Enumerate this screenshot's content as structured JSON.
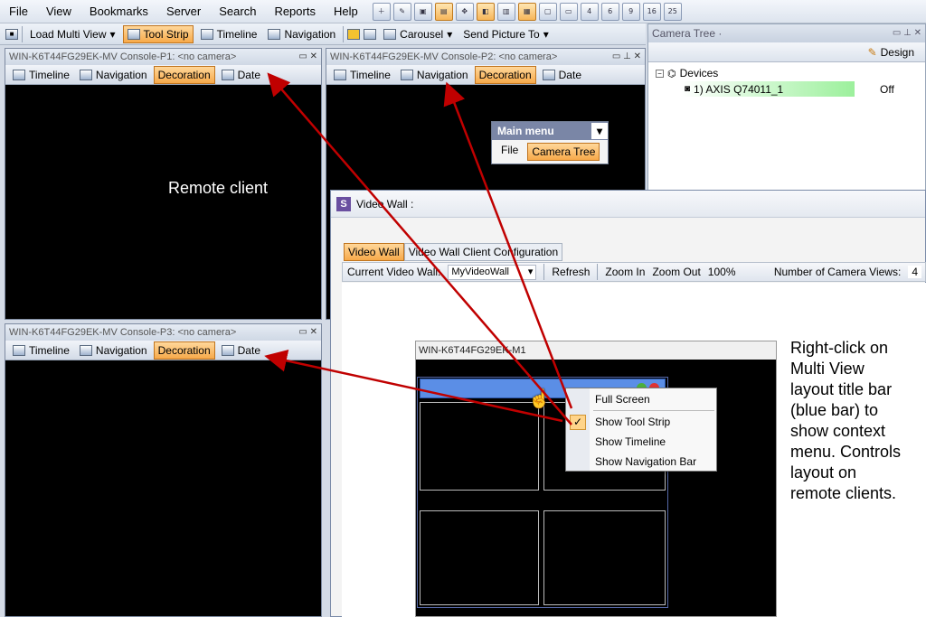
{
  "menubar": {
    "items": [
      "File",
      "View",
      "Bookmarks",
      "Server",
      "Search",
      "Reports",
      "Help"
    ],
    "icon_labels": [
      "",
      "",
      "",
      "",
      "",
      "",
      "",
      "",
      "",
      "",
      "4",
      "6",
      "9",
      "16",
      "25"
    ]
  },
  "toolbar": {
    "load_multi_view": "Load Multi View",
    "tool_strip": "Tool Strip",
    "timeline": "Timeline",
    "navigation": "Navigation",
    "carousel": "Carousel",
    "send_picture_to": "Send Picture To"
  },
  "panes": [
    {
      "title": "WIN-K6T44FG29EK-MV Console-P1: <no camera>",
      "timeline": "Timeline",
      "navigation": "Navigation",
      "decoration": "Decoration",
      "date": "Date",
      "overlay": "Remote client"
    },
    {
      "title": "WIN-K6T44FG29EK-MV Console-P2: <no camera>",
      "timeline": "Timeline",
      "navigation": "Navigation",
      "decoration": "Decoration",
      "date": "Date"
    },
    {
      "title": "WIN-K6T44FG29EK-MV Console-P3: <no camera>",
      "timeline": "Timeline",
      "navigation": "Navigation",
      "decoration": "Decoration",
      "date": "Date"
    }
  ],
  "main_menu": {
    "title": "Main menu",
    "file": "File",
    "camera_tree": "Camera Tree"
  },
  "camera_tree": {
    "title": "Camera Tree ·",
    "design": "Design",
    "devices": "Devices",
    "camera": "1) AXIS Q74011_1",
    "status": "Off"
  },
  "video_wall": {
    "title": "Video Wall :",
    "tabs": [
      "Video Wall",
      "Video Wall Client Configuration"
    ],
    "current_label": "Current Video Wall:",
    "current_value": "MyVideoWall",
    "refresh": "Refresh",
    "zoom_in": "Zoom In",
    "zoom_out": "Zoom Out",
    "zoom_level": "100%",
    "num_views_label": "Number of Camera Views:",
    "num_views_value": "4",
    "layout_title": "WIN-K6T44FG29EK-M1"
  },
  "context_menu": {
    "full_screen": "Full Screen",
    "show_tool_strip": "Show Tool Strip",
    "show_timeline": "Show Timeline",
    "show_navigation_bar": "Show Navigation Bar"
  },
  "annotation": {
    "lines": [
      "Right-click on",
      "Multi View",
      "layout title bar",
      "(blue bar) to",
      "show context",
      "menu. Controls",
      "layout on",
      "remote clients."
    ]
  },
  "colors": {
    "accent": "#f7a94a",
    "arrow": "#c00000",
    "title_bar_blue": "#5b8ee6",
    "tree_highlight": "#9cf09c"
  }
}
